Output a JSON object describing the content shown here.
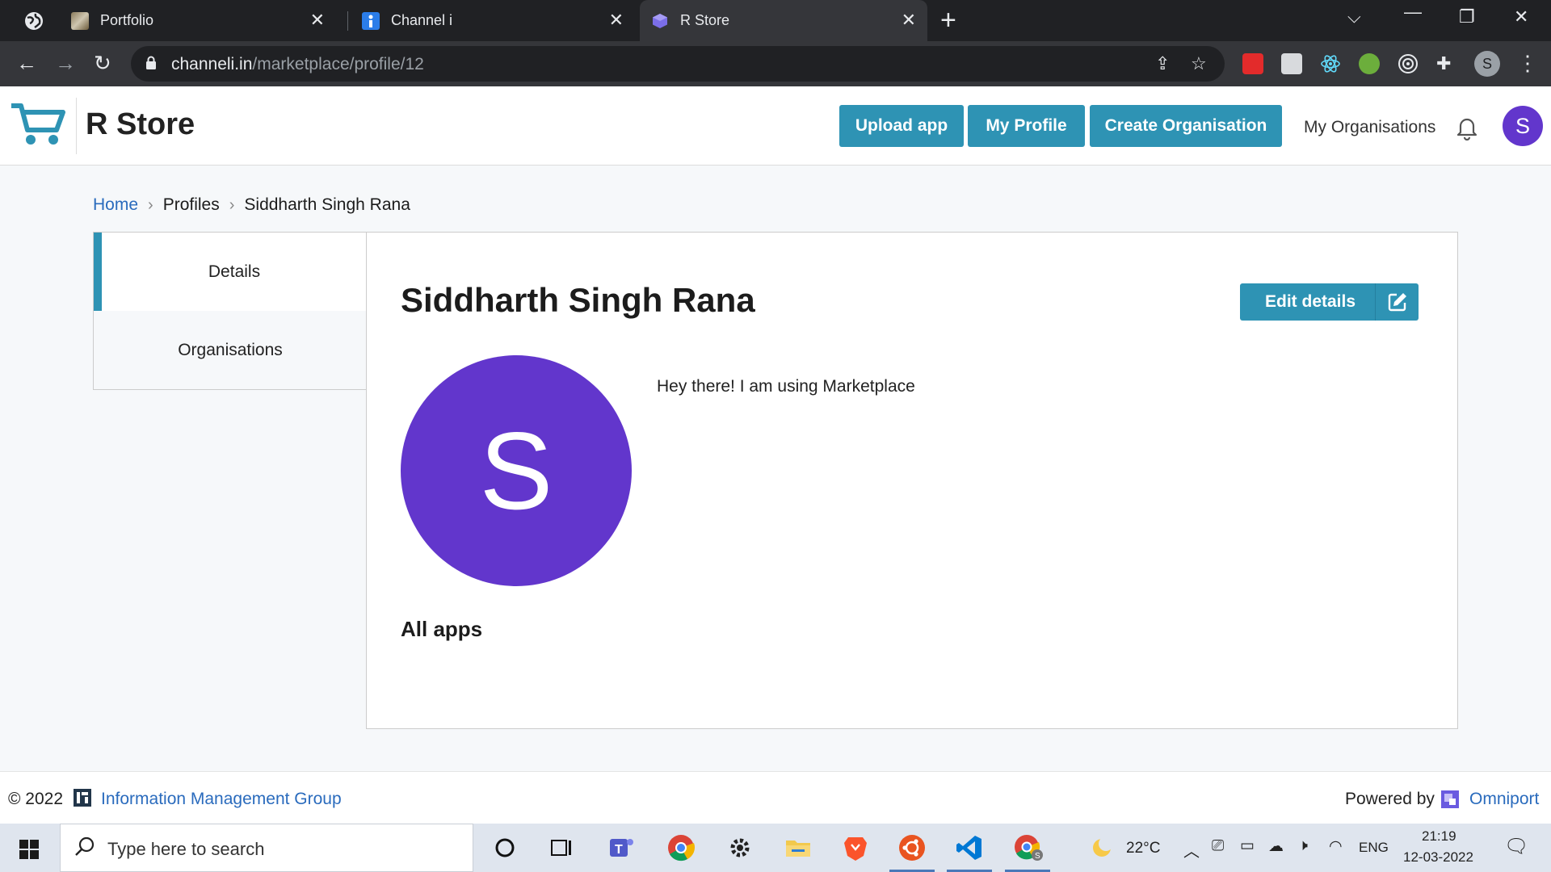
{
  "browser": {
    "tabs": [
      {
        "title": "Portfolio",
        "active": false
      },
      {
        "title": "Channel i",
        "active": false
      },
      {
        "title": "R Store",
        "active": true
      }
    ],
    "url_domain": "channeli.in",
    "url_path": "/marketplace/profile/12",
    "profile_initial": "S"
  },
  "header": {
    "title": "R Store",
    "upload_label": "Upload app",
    "profile_label": "My Profile",
    "create_org_label": "Create Organisation",
    "my_orgs_label": "My Organisations",
    "avatar_initial": "S",
    "accent_color": "#2e93b4",
    "avatar_color": "#6236cc"
  },
  "breadcrumb": {
    "home": "Home",
    "profiles": "Profiles",
    "current": "Siddharth Singh Rana"
  },
  "sidebar": {
    "items": [
      {
        "label": "Details",
        "active": true
      },
      {
        "label": "Organisations",
        "active": false
      }
    ]
  },
  "profile": {
    "name": "Siddharth Singh Rana",
    "edit_label": "Edit details",
    "avatar_initial": "S",
    "bio": "Hey there! I am using Marketplace",
    "all_apps_heading": "All apps"
  },
  "footer": {
    "copyright": "© 2022",
    "group_link": "Information Management Group",
    "powered_by": "Powered by",
    "omniport_link": "Omniport"
  },
  "taskbar": {
    "search_placeholder": "Type here to search",
    "weather": "22°C",
    "language": "ENG",
    "time": "21:19",
    "date": "12-03-2022"
  }
}
